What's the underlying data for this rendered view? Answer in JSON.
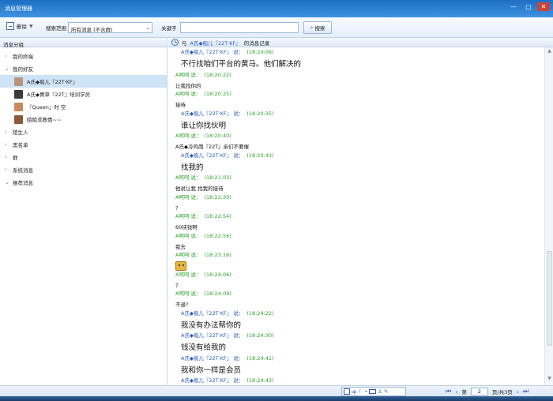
{
  "window": {
    "title": "消息管理器",
    "minimize": "—",
    "maximize": "□",
    "close": "✕"
  },
  "toolbar": {
    "delete_label": "删除",
    "scope_label": "搜索范围",
    "scope_value": "所有消息 (不含群)",
    "keyword_label": "关键字",
    "keyword_value": "",
    "search_label": "搜索"
  },
  "sidebar": {
    "header": "消息分组",
    "groups": [
      {
        "label": "我的终端",
        "expanded": false
      },
      {
        "label": "我的好友",
        "expanded": true
      }
    ],
    "contacts": [
      {
        "name": "A氏◆痴儿『22T·KF』",
        "selected": true,
        "color": "#b89478"
      },
      {
        "name": "A氏◆菁草『22T』培训学员",
        "selected": false,
        "color": "#3a3a3a"
      },
      {
        "name": "『Queen』时 空",
        "selected": false,
        "color": "#c88b5b"
      },
      {
        "name": "陌陌求教情~~",
        "selected": false,
        "color": "#8a5a3a"
      }
    ],
    "groups_after": [
      {
        "label": "陌生人"
      },
      {
        "label": "黑名单"
      },
      {
        "label": "群"
      },
      {
        "label": "系统消息"
      },
      {
        "label": "推荐消息"
      }
    ]
  },
  "chat": {
    "header_prefix": "与",
    "header_name": "A氏◆痴儿『22T·KF』",
    "header_suffix": "的消息记录",
    "messages": [
      {
        "sender": "A氏◆痴儿『22T·KF』 说：",
        "time": "(18:20:06)",
        "text": "不行找咱们平台的黄马。他们解决的",
        "peer": true,
        "big": true
      },
      {
        "sender": "A呵呵 说：",
        "time": "(18:20:22)",
        "text": "让我找你的",
        "peer": false,
        "big": false
      },
      {
        "sender": "A呵呵 说：",
        "time": "(18:20:25)",
        "text": "接待",
        "peer": false,
        "big": false
      },
      {
        "sender": "A氏◆痴儿『22T·KF』 说：",
        "time": "(18:20:35)",
        "text": "谁让你找伙明",
        "peer": true,
        "big": true
      },
      {
        "sender": "A呵呵 说：",
        "time": "(18:20:40)",
        "text": "A氏◆冷鸡雨『22T』亲们不要催",
        "peer": false,
        "big": false
      },
      {
        "sender": "A氏◆痴儿『22T·KF』 说：",
        "time": "(18:20:43)",
        "text": "找我的",
        "peer": true,
        "big": true
      },
      {
        "sender": "A呵呵 说：",
        "time": "(18:21:03)",
        "text": "他说让我 找我的接待",
        "peer": false,
        "big": false
      },
      {
        "sender": "A呵呵 说：",
        "time": "(18:22:30)",
        "text": "？",
        "peer": false,
        "big": false
      },
      {
        "sender": "A呵呵 说：",
        "time": "(18:22:54)",
        "text": "60块钱啊",
        "peer": false,
        "big": false
      },
      {
        "sender": "A呵呵 说：",
        "time": "(18:22:56)",
        "text": "我去",
        "peer": false,
        "big": false
      },
      {
        "sender": "A呵呵 说：",
        "time": "(18:23:16)",
        "text": "",
        "peer": false,
        "big": false,
        "emoji": true
      },
      {
        "sender": "A呵呵 说：",
        "time": "(18:24:06)",
        "text": "？",
        "peer": false,
        "big": false
      },
      {
        "sender": "A呵呵 说：",
        "time": "(18:24:09)",
        "text": "不退?",
        "peer": false,
        "big": false
      },
      {
        "sender": "A氏◆痴儿『22T·KF』 说：",
        "time": "(18:24:22)",
        "text": "我没有办法帮你的",
        "peer": true,
        "big": true
      },
      {
        "sender": "A氏◆痴儿『22T·KF』 说：",
        "time": "(18:24:30)",
        "text": "钱没有给我的",
        "peer": true,
        "big": true
      },
      {
        "sender": "A氏◆痴儿『22T·KF』 说：",
        "time": "(18:24:41)",
        "text": "我和你一样是会员",
        "peer": true,
        "big": true
      },
      {
        "sender": "A氏◆痴儿『22T·KF』 说：",
        "time": "(18:24:43)",
        "text": "",
        "peer": true,
        "big": true
      }
    ]
  },
  "statusbar": {
    "tools": "中",
    "pager_prefix": "第",
    "page": "2",
    "pager_suffix": "页/共3页"
  }
}
